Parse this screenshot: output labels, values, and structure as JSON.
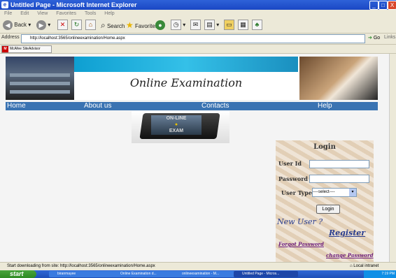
{
  "window": {
    "title": "Untitled Page - Microsoft Internet Explorer",
    "controls": [
      "_",
      "□",
      "X"
    ]
  },
  "menu": [
    "File",
    "Edit",
    "View",
    "Favorites",
    "Tools",
    "Help"
  ],
  "toolbar": {
    "back": "Back",
    "search": "Search",
    "favorites": "Favorites"
  },
  "address": {
    "label": "Address",
    "url": "http://localhost:3565/onlineexamination/Home.aspx",
    "go": "Go",
    "links": "Links"
  },
  "mcafee": "McAfee SiteAdvisor",
  "site": {
    "title": "Online Examination",
    "nav": [
      "Home",
      "About us",
      "Contacts",
      "Help"
    ],
    "exam_image_text": [
      "ON-LINE",
      "EXAM"
    ]
  },
  "login": {
    "heading": "Login",
    "user_id_label": "User Id",
    "password_label": "Password",
    "user_type_label": "User Type",
    "user_type_selected": "----select----",
    "login_button": "Login",
    "new_user": "New User ?",
    "register": "Register",
    "forgot_password": "Forgot Password",
    "change_password": "change Password"
  },
  "status": {
    "message": "Start downloading from site: http://localhost:3565/onlineexamination/Home.aspx",
    "zone": "Local intranet"
  },
  "taskbar": {
    "start": "start",
    "tasks": [
      "biranmayee",
      "Online Examination d...",
      "onlineexamination - M...",
      "Untitled Page - Micros..."
    ],
    "time": "7:19 PM"
  },
  "colors": {
    "nav": "#3a73b2",
    "titlebar": "#1a47c4",
    "link": "#2a3d8f"
  }
}
